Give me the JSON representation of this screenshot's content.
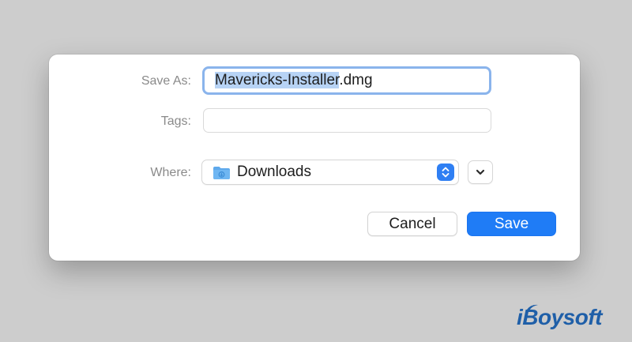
{
  "dialog": {
    "save_as_label": "Save As:",
    "filename_selected": "Mavericks-Installer",
    "filename_extension": ".dmg",
    "tags_label": "Tags:",
    "tags_value": "",
    "where_label": "Where:",
    "where_value": "Downloads",
    "cancel_label": "Cancel",
    "save_label": "Save"
  },
  "icons": {
    "folder": "folder-icon",
    "stepper": "up-down-chevron-icon",
    "expand": "chevron-down-icon"
  },
  "watermark": {
    "text": "iBoysoft"
  },
  "colors": {
    "accent": "#1f7cf6",
    "focus_ring": "#8ab4ec",
    "selection": "#b7d3f5",
    "watermark": "#1f5fa8"
  }
}
